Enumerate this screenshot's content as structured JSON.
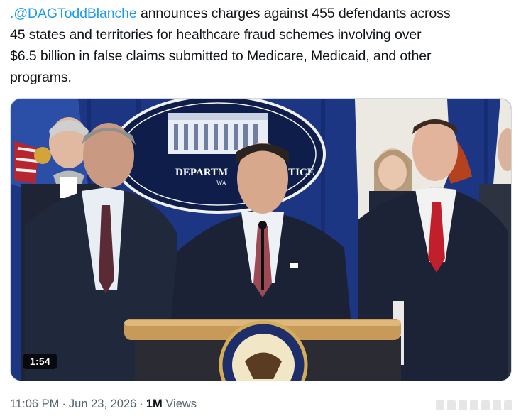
{
  "tweet": {
    "mention": ".@DAGToddBlanche",
    "text_line1_rest": " announces charges against 455 defendants across",
    "text_line2": "45 states and territories for healthcare fraud schemes involving over",
    "text_line3": "$6.5 billion in false claims submitted to Medicare, Medicaid, and other",
    "text_line4": "programs."
  },
  "media": {
    "duration": "1:54",
    "podium_banner_left": "DEPARTM",
    "podium_banner_right": "USTICE",
    "podium_banner_sub": "WA",
    "seal_text": "DEPARTMENT OF JUSTICE"
  },
  "meta": {
    "time": "11:06 PM",
    "dot1": "·",
    "date": "Jun 23, 2026",
    "dot2": "·",
    "views_count": "1M",
    "views_label": " Views"
  }
}
